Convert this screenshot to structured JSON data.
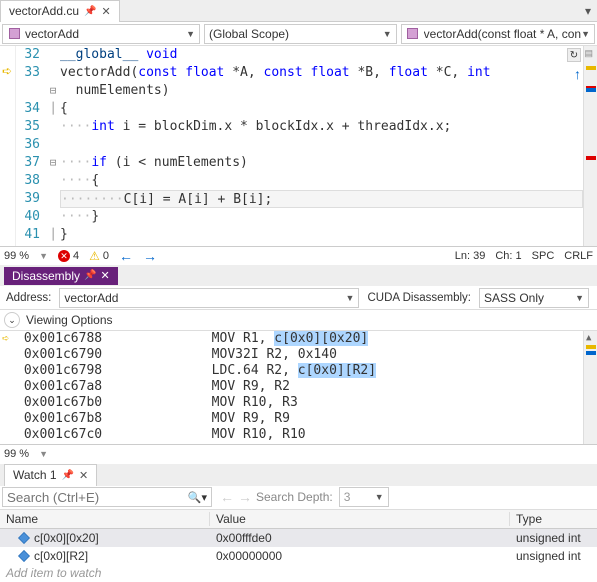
{
  "editor": {
    "tab_name": "vectorAdd.cu",
    "scope_combo": "vectorAdd",
    "global_scope": "(Global Scope)",
    "func_combo": "vectorAdd(const float * A, con",
    "lines": [
      {
        "n": 32,
        "text": "__global__ void"
      },
      {
        "n": 33,
        "text": "vectorAdd(const float *A, const float *B, float *C, int"
      },
      {
        "n": "",
        "text": "  numElements)"
      },
      {
        "n": 34,
        "text": "{"
      },
      {
        "n": 35,
        "text": "····int i = blockDim.x * blockIdx.x + threadIdx.x;"
      },
      {
        "n": 36,
        "text": ""
      },
      {
        "n": 37,
        "text": "····if (i < numElements)"
      },
      {
        "n": 38,
        "text": "····{"
      },
      {
        "n": 39,
        "text": "········C[i] = A[i] + B[i];"
      },
      {
        "n": 40,
        "text": "····}"
      },
      {
        "n": 41,
        "text": "}"
      }
    ],
    "zoom": "99 %",
    "errors": "4",
    "warnings": "0",
    "ln_label": "Ln: 39",
    "ch_label": "Ch: 1",
    "spc": "SPC",
    "crlf": "CRLF"
  },
  "disasm": {
    "title": "Disassembly",
    "addr_label": "Address:",
    "addr_value": "vectorAdd",
    "cuda_label": "CUDA Disassembly:",
    "cuda_value": "SASS Only",
    "view_options": "Viewing Options",
    "lines": [
      {
        "addr": "0x001c6788",
        "op": "MOV R1, ",
        "arg": "c[0x0][0x20]",
        "sel": true
      },
      {
        "addr": "0x001c6790",
        "op": "MOV32I R2, 0x140",
        "arg": "",
        "sel": false
      },
      {
        "addr": "0x001c6798",
        "op": "LDC.64 R2, ",
        "arg": "c[0x0][R2]",
        "sel": true
      },
      {
        "addr": "0x001c67a8",
        "op": "MOV R9, R2",
        "arg": "",
        "sel": false
      },
      {
        "addr": "0x001c67b0",
        "op": "MOV R10, R3",
        "arg": "",
        "sel": false
      },
      {
        "addr": "0x001c67b8",
        "op": "MOV R9, R9",
        "arg": "",
        "sel": false
      },
      {
        "addr": "0x001c67c0",
        "op": "MOV R10, R10",
        "arg": "",
        "sel": false
      }
    ],
    "zoom": "99 %"
  },
  "watch": {
    "title": "Watch 1",
    "search_placeholder": "Search (Ctrl+E)",
    "depth_label": "Search Depth:",
    "depth_value": "3",
    "col_name": "Name",
    "col_value": "Value",
    "col_type": "Type",
    "rows": [
      {
        "name": "c[0x0][0x20]",
        "value": "0x00fffde0",
        "type": "unsigned int",
        "hl": true
      },
      {
        "name": "c[0x0][R2]",
        "value": "0x00000000",
        "type": "unsigned int",
        "hl": false
      }
    ],
    "add_item": "Add item to watch"
  }
}
